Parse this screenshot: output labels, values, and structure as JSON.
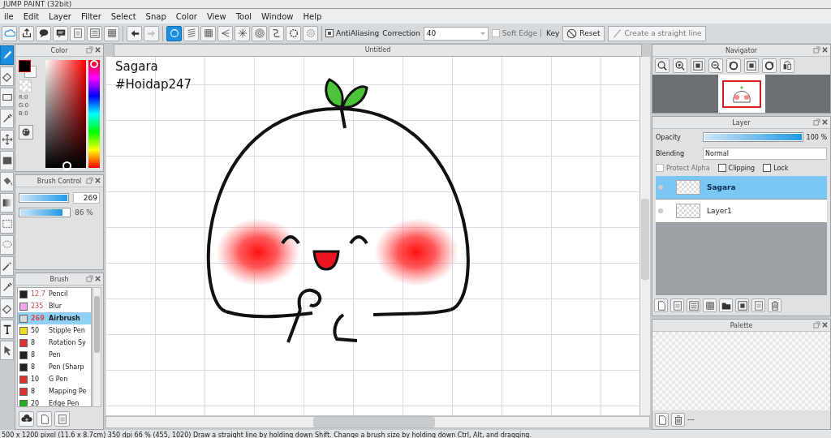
{
  "window": {
    "title": "JUMP PAINT (32bit)"
  },
  "menu": [
    "ile",
    "Edit",
    "Layer",
    "Filter",
    "Select",
    "Snap",
    "Color",
    "View",
    "Tool",
    "Window",
    "Help"
  ],
  "toolbar": {
    "file_tools": [
      {
        "kind": "cloud"
      },
      {
        "kind": "share"
      },
      {
        "kind": "bubble"
      },
      {
        "kind": "comment"
      },
      {
        "kind": "page"
      },
      {
        "kind": "list"
      },
      {
        "kind": "grid"
      }
    ],
    "history": [
      {
        "kind": "undo",
        "disabled": false
      },
      {
        "kind": "redo",
        "disabled": true
      }
    ],
    "ruler_tools": [
      {
        "kind": "circle",
        "selected": true
      },
      {
        "kind": "lines",
        "selected": false
      },
      {
        "kind": "grid",
        "selected": false
      },
      {
        "kind": "perspective",
        "selected": false
      },
      {
        "kind": "burst",
        "selected": false
      },
      {
        "kind": "rings",
        "selected": false
      },
      {
        "kind": "curve",
        "selected": false
      },
      {
        "kind": "dotted-circle",
        "selected": false
      },
      {
        "kind": "gear",
        "selected": false
      }
    ],
    "antialiasing": {
      "label": "AntiAliasing",
      "checked": true
    },
    "correction": {
      "label": "Correction",
      "value": "40"
    },
    "soft_edge": {
      "label": "Soft Edge",
      "checked": false,
      "disabled": true
    },
    "key": "Key",
    "reset": "Reset",
    "straight_line": {
      "label": "Create a straight line",
      "disabled": true
    }
  },
  "tools": [
    {
      "kind": "pen",
      "selected": true
    },
    {
      "kind": "eraser",
      "selected": false
    },
    {
      "kind": "rect",
      "selected": false
    },
    {
      "kind": "dropper",
      "selected": false
    },
    {
      "kind": "move",
      "selected": false
    },
    {
      "kind": "fill",
      "selected": false
    },
    {
      "kind": "bucket",
      "selected": false
    },
    {
      "kind": "gradient",
      "selected": false
    },
    {
      "kind": "select",
      "selected": false
    },
    {
      "kind": "lasso",
      "selected": false
    },
    {
      "kind": "wand",
      "selected": false
    },
    {
      "kind": "dropper",
      "selected": false
    },
    {
      "kind": "eraser",
      "selected": false
    },
    {
      "kind": "text",
      "selected": false
    },
    {
      "kind": "pointer",
      "selected": false
    }
  ],
  "color_panel": {
    "title": "Color",
    "rgb": [
      "R:0",
      "G:0",
      "B:0"
    ],
    "hue": {
      "level": 1
    }
  },
  "brush_control": {
    "title": "Brush Control",
    "sliders": [
      {
        "kind": "field",
        "level": 1,
        "reading": "269"
      },
      {
        "kind": "text",
        "level": 0.86,
        "reading": "86 %"
      }
    ]
  },
  "brush": {
    "title": "Brush",
    "items": [
      {
        "size": "12.7",
        "name": "Pencil",
        "color": "#222222",
        "custom": true,
        "selected": false
      },
      {
        "size": "235",
        "name": "Blur",
        "color": "#f4a6f0",
        "custom": true,
        "selected": false
      },
      {
        "size": "269",
        "name": "Airbrush",
        "color": "#d8d8d8",
        "custom": true,
        "selected": true
      },
      {
        "size": "50",
        "name": "Stipple Pen",
        "color": "#f2e01c",
        "custom": false,
        "selected": false
      },
      {
        "size": "8",
        "name": "Rotation Sy",
        "color": "#e03030",
        "custom": false,
        "selected": false
      },
      {
        "size": "8",
        "name": "Pen",
        "color": "#222222",
        "custom": false,
        "selected": false
      },
      {
        "size": "8",
        "name": "Pen (Sharp",
        "color": "#222222",
        "custom": false,
        "selected": false
      },
      {
        "size": "10",
        "name": "G Pen",
        "color": "#e03030",
        "custom": false,
        "selected": false
      },
      {
        "size": "8",
        "name": "Mapping Pe",
        "color": "#e03030",
        "custom": false,
        "selected": false
      },
      {
        "size": "20",
        "name": "Edge Pen",
        "color": "#22b022",
        "custom": false,
        "selected": false
      }
    ]
  },
  "document": {
    "tab": "Untitled",
    "texts": [
      "Sagara",
      "#Hoidap247"
    ]
  },
  "navigator": {
    "title": "Navigator",
    "tools": [
      {
        "kind": "zoom-reset"
      },
      {
        "kind": "zoom-in"
      },
      {
        "kind": "fit"
      },
      {
        "kind": "zoom-out"
      },
      {
        "kind": "rotate-left"
      },
      {
        "kind": "fit"
      },
      {
        "kind": "rotate-right"
      },
      {
        "kind": "flip"
      }
    ]
  },
  "layer": {
    "title": "Layer",
    "opacity": {
      "label": "Opacity",
      "level": 1,
      "reading": "100 %"
    },
    "blending": {
      "label": "Blending",
      "value": "Normal"
    },
    "options": [
      {
        "label": "Protect Alpha",
        "checked": false,
        "disabled": true
      },
      {
        "label": "Clipping",
        "checked": false,
        "disabled": false
      },
      {
        "label": "Lock",
        "checked": false,
        "disabled": false
      }
    ],
    "layers": [
      {
        "name": "Sagara",
        "selected": true
      },
      {
        "name": "Layer1",
        "selected": false
      }
    ]
  },
  "palette": {
    "title": "Palette",
    "footer": "---"
  },
  "status_bar": "500 x 1200 pixel (11.6 x 8.7cm) 350 dpi 66 % (455, 1020) Draw a straight line by holding down Shift. Change a brush size by holding down Ctrl, Alt, and dragging."
}
